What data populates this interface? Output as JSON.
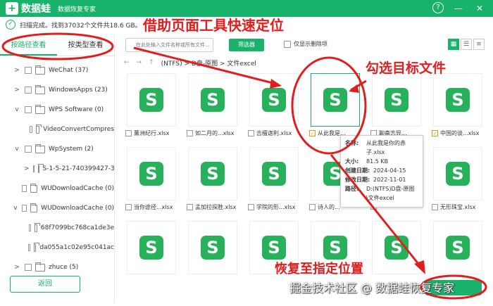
{
  "app": {
    "name": "数据蛙",
    "subtitle": "数据恢复专家",
    "icon": "logo-icon"
  },
  "window_buttons": [
    "?",
    "—",
    "✕"
  ],
  "status": {
    "text": "扫描完成。找到37032个文件共18.6 GB。"
  },
  "tabs": [
    {
      "label": "按路径查看",
      "active": true
    },
    {
      "label": "按类型查看",
      "active": false
    }
  ],
  "tree": [
    {
      "caret": ">",
      "label": "WeChat (37)"
    },
    {
      "caret": ">",
      "label": "WindowsApps (23)"
    },
    {
      "caret": "v",
      "label": "WPS Software (0)"
    },
    {
      "caret": "",
      "label": "VideoConvertCompres"
    },
    {
      "caret": "v",
      "label": "WpSystem (2)"
    },
    {
      "caret": ">",
      "label": "S-1-5-21-740399427-3"
    },
    {
      "caret": "",
      "label": "WUDownloadCache (0)"
    },
    {
      "caret": "v",
      "label": "WUDownloadCache (0)"
    },
    {
      "caret": "",
      "label": "68f7099bc768ca1de3e"
    },
    {
      "caret": "",
      "label": "da055a1c02e95c041ac"
    },
    {
      "caret": ">",
      "label": "zhuce (5)"
    }
  ],
  "back_button": "返回",
  "toolbar": {
    "search_placeholder": "在此处输入文件名称或所有文件...",
    "filter_label": "筛选器",
    "only_deleted_label": "仅显示删除项",
    "view_icons": [
      "grid-view-icon",
      "list-view-icon",
      "detail-view-icon"
    ]
  },
  "path": "(NTFS) > D盘-原图 > 文件excel",
  "files": [
    {
      "name": "薰洲纪行.xlsx",
      "checked": false
    },
    {
      "name": "如二月的...xlsx",
      "checked": false
    },
    {
      "name": "吉檀迦利.xlsx",
      "checked": false
    },
    {
      "name": "从此我是...",
      "checked": true,
      "selected": true
    },
    {
      "name": "聊斋志异...",
      "checked": false
    },
    {
      "name": "中国的谈...xlsx",
      "checked": true
    },
    {
      "name": "当你途径...xlsx",
      "checked": false
    },
    {
      "name": "孟加拉探胜.xlsx",
      "checked": false
    },
    {
      "name": "学院的形...xlsx",
      "checked": false
    },
    {
      "name": "诗人的...",
      "checked": false
    },
    {
      "name": "",
      "checked": false
    },
    {
      "name": "无形珠宝.xlsx",
      "checked": false
    },
    {
      "name": "",
      "checked": false
    },
    {
      "name": "",
      "checked": false
    },
    {
      "name": "",
      "checked": false
    },
    {
      "name": "",
      "checked": false
    },
    {
      "name": "",
      "checked": false
    },
    {
      "name": "",
      "checked": false
    }
  ],
  "tooltip": {
    "name_label": "名称:",
    "name": "从此我是你的赤子.xlsx",
    "size_label": "大小:",
    "size": "81.5 KB",
    "created_label": "创建日期:",
    "created": "2024-04-15",
    "modified_label": "修改日期:",
    "modified": "2022-11-01",
    "path_label": "路径:",
    "path": "D:(NTFS)D盘-原图\\文件excel"
  },
  "annotations": {
    "locate": "借助页面工具快速定位",
    "select": "勾选目标文件",
    "restore": "恢复至指定位置"
  },
  "watermark": "掘金技术社区 @ 数据蛙恢复专家",
  "colors": {
    "brand": "#19b26b",
    "annotation": "#e01e1e"
  }
}
